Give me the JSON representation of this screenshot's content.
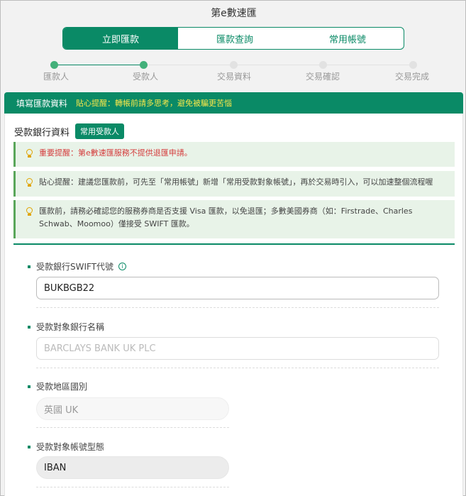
{
  "app_title": "第e數速匯",
  "tabs": [
    {
      "label": "立即匯款",
      "active": true
    },
    {
      "label": "匯款查詢",
      "active": false
    },
    {
      "label": "常用帳號",
      "active": false
    }
  ],
  "steps": [
    {
      "label": "匯款人",
      "done": true
    },
    {
      "label": "受款人",
      "done": true
    },
    {
      "label": "交易資料",
      "done": false
    },
    {
      "label": "交易確認",
      "done": false
    },
    {
      "label": "交易完成",
      "done": false
    }
  ],
  "section": {
    "title": "填寫匯款資料",
    "tip": "貼心提醒：轉帳前請多思考，避免被騙更苦惱"
  },
  "bank": {
    "title": "受款銀行資料",
    "common_button": "常用受款人"
  },
  "notices": [
    {
      "text": "重要提醒：第e數速匯服務不提供退匯申請。",
      "type": "red"
    },
    {
      "text": "貼心提醒：建議您匯款前，可先至「常用帳號」新增「常用受款對象帳號」，再於交易時引入，可以加速整個流程喔",
      "type": "normal"
    },
    {
      "text": "匯款前，請務必確認您的服務券商是否支援 Visa 匯款，以免退匯；多數美國券商（如：Firstrade、Charles Schwab、Moomoo）僅接受 SWIFT 匯款。",
      "type": "normal"
    }
  ],
  "fields": {
    "swift": {
      "label": "受款銀行SWIFT代號",
      "value": "BUKBGB22"
    },
    "bank_name": {
      "label": "受款對象銀行名稱",
      "value": "BARCLAYS BANK UK PLC"
    },
    "region": {
      "label": "受款地區國別",
      "value": "英國 UK"
    },
    "account_type": {
      "label": "受款對象帳號型態",
      "value": "IBAN"
    }
  },
  "colors": {
    "brand": "#0a8a66",
    "tip_yellow": "#f6e64b",
    "notice_bg": "#e8f3e8",
    "warning_red": "#d43c3c"
  }
}
